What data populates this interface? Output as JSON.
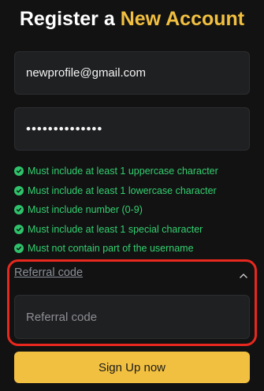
{
  "header": {
    "title_part1": "Register a",
    "title_part2": "New Account"
  },
  "form": {
    "email_value": "newprofile@gmail.com",
    "password_value": "••••••••••••••",
    "rules": [
      "Must include at least 1 uppercase character",
      "Must include at least 1 lowercase character",
      "Must include number (0-9)",
      "Must include at least 1 special character",
      "Must not contain part of the username"
    ],
    "referral_toggle": "Referral code",
    "referral_placeholder": "Referral code",
    "submit_label": "Sign Up now"
  },
  "colors": {
    "background": "#121212",
    "accent": "#f2c040",
    "success": "#33d070",
    "highlight": "#e8281e"
  },
  "icons": {
    "rule_icon": "check-circle-icon",
    "collapse_icon": "chevron-up-icon"
  }
}
